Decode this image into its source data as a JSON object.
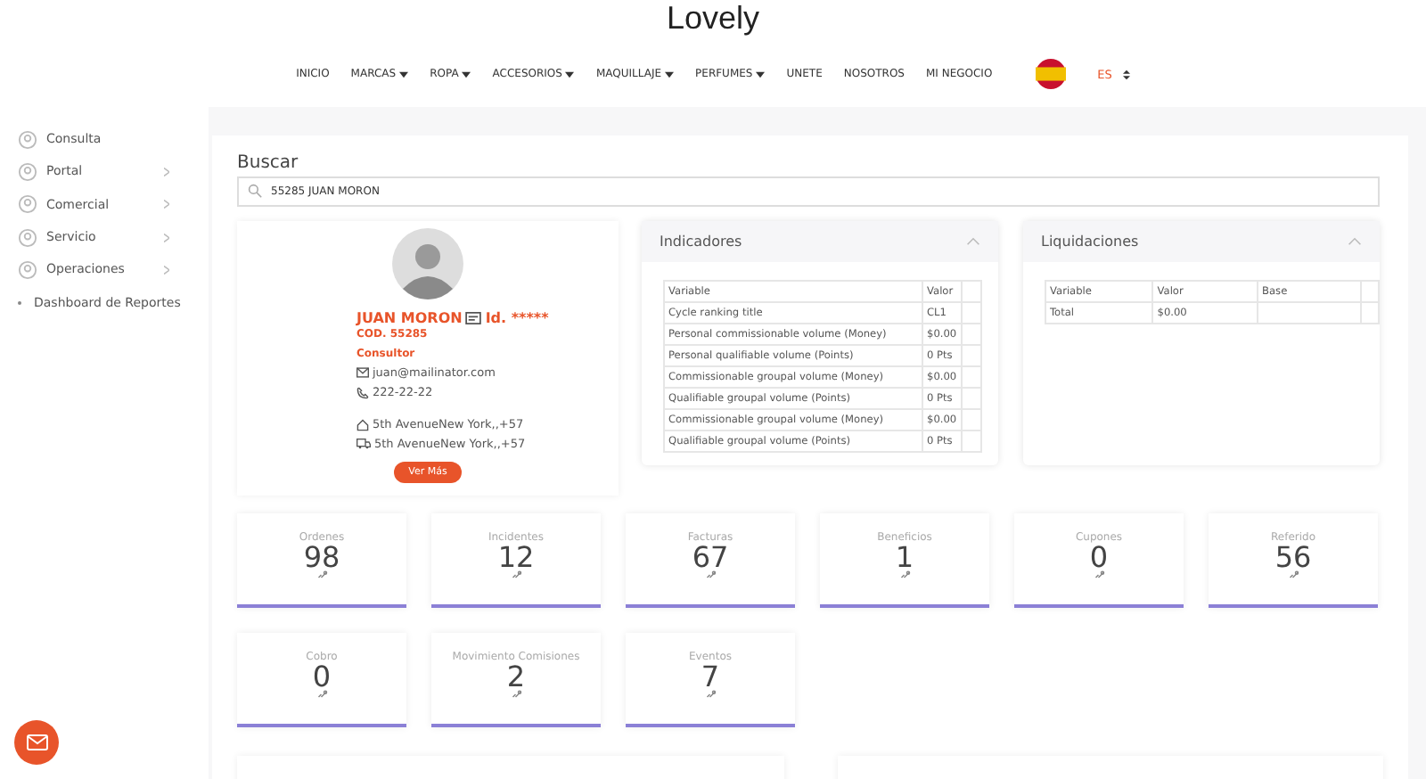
{
  "logo": "Lovely",
  "nav": [
    {
      "label": "INICIO",
      "dropdown": false
    },
    {
      "label": "MARCAS",
      "dropdown": true
    },
    {
      "label": "ROPA",
      "dropdown": true
    },
    {
      "label": "ACCESORIOS",
      "dropdown": true
    },
    {
      "label": "MAQUILLAJE",
      "dropdown": true
    },
    {
      "label": "PERFUMES",
      "dropdown": true
    },
    {
      "label": "UNETE",
      "dropdown": false
    },
    {
      "label": "NOSOTROS",
      "dropdown": false
    },
    {
      "label": "MI NEGOCIO",
      "dropdown": false
    }
  ],
  "language": "ES",
  "sidebar": [
    {
      "label": "Consulta",
      "kind": "icon",
      "expandable": false
    },
    {
      "label": "Portal",
      "kind": "icon",
      "expandable": true
    },
    {
      "label": "Comercial",
      "kind": "icon",
      "expandable": true
    },
    {
      "label": "Servicio",
      "kind": "icon",
      "expandable": true
    },
    {
      "label": "Operaciones",
      "kind": "icon",
      "expandable": true
    },
    {
      "label": "Dashboard de Reportes",
      "kind": "bullet",
      "expandable": false
    }
  ],
  "search": {
    "title": "Buscar",
    "value": "55285 JUAN MORON"
  },
  "profile": {
    "name": "JUAN MORON",
    "id": "Id. *****",
    "code": "COD. 55285",
    "role": "Consultor",
    "email": "juan@mailinator.com",
    "phone": "222-22-22",
    "address": "5th AvenueNew York,,+57",
    "shipping": "5th AvenueNew York,,+57",
    "button": "Ver Más"
  },
  "indicadores": {
    "title": "Indicadores",
    "columns": [
      "Variable",
      "Valor"
    ],
    "rows": [
      [
        "Cycle ranking title",
        "CL1"
      ],
      [
        "Personal commissionable volume (Money)",
        "$0.00"
      ],
      [
        "Personal qualifiable volume (Points)",
        "0 Pts"
      ],
      [
        "Commissionable groupal volume (Money)",
        "$0.00"
      ],
      [
        "Qualifiable groupal volume (Points)",
        "0 Pts"
      ],
      [
        "Commissionable groupal volume (Money)",
        "$0.00"
      ],
      [
        "Qualifiable groupal volume (Points)",
        "0 Pts"
      ]
    ]
  },
  "liquidaciones": {
    "title": "Liquidaciones",
    "columns": [
      "Variable",
      "Valor",
      "Base"
    ],
    "rows": [
      [
        "Total",
        "$0.00",
        ""
      ]
    ]
  },
  "stats": [
    {
      "label": "Ordenes",
      "value": "98"
    },
    {
      "label": "Incidentes",
      "value": "12"
    },
    {
      "label": "Facturas",
      "value": "67"
    },
    {
      "label": "Beneficios",
      "value": "1"
    },
    {
      "label": "Cupones",
      "value": "0"
    },
    {
      "label": "Referido",
      "value": "56"
    },
    {
      "label": "Cobro",
      "value": "0"
    },
    {
      "label": "Movimiento Comisiones",
      "value": "2"
    },
    {
      "label": "Eventos",
      "value": "7"
    }
  ]
}
